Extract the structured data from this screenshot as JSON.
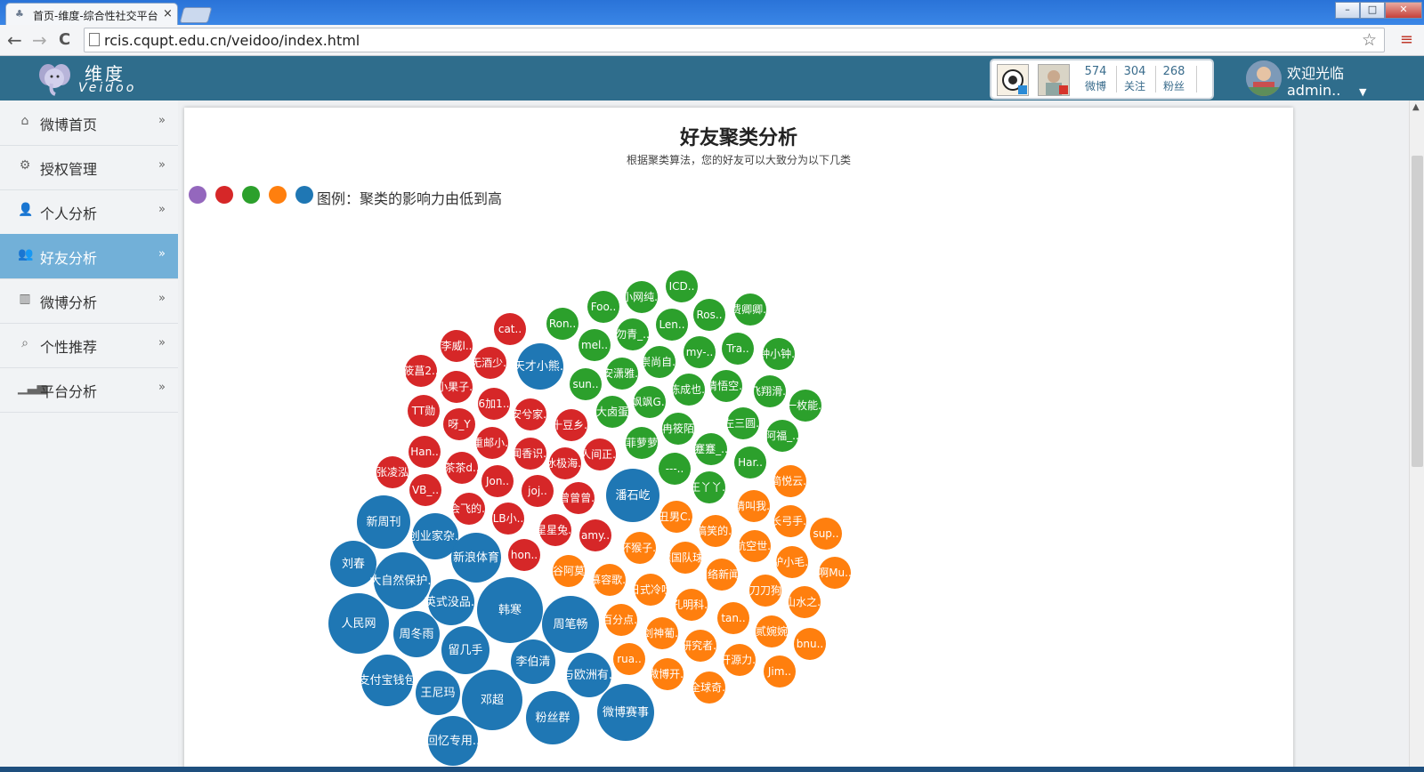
{
  "browser": {
    "tab_title": "首页-维度-综合性社交平台",
    "tab_close": "×",
    "url": "rcis.cqupt.edu.cn/veidoo/index.html",
    "back": "←",
    "forward": "→",
    "reload": "C",
    "star": "☆",
    "menu": "≡",
    "win_min": "–",
    "win_max": "□",
    "win_close": "✕"
  },
  "header": {
    "logo_title": "维度",
    "logo_sub": "Veidoo",
    "stats": [
      {
        "value": "574",
        "label": "微博"
      },
      {
        "value": "304",
        "label": "关注"
      },
      {
        "value": "268",
        "label": "粉丝"
      }
    ],
    "welcome": "欢迎光临",
    "user": "admin..",
    "caret": "▼"
  },
  "sidebar": {
    "items": [
      {
        "label": "微博首页",
        "icon": "home-icon",
        "glyph": "⌂",
        "arrow": "»"
      },
      {
        "label": "授权管理",
        "icon": "gears-icon",
        "glyph": "⚙",
        "arrow": "»"
      },
      {
        "label": "个人分析",
        "icon": "user-icon",
        "glyph": "👤",
        "arrow": "»"
      },
      {
        "label": "好友分析",
        "icon": "users-icon",
        "glyph": "👥",
        "arrow": "»"
      },
      {
        "label": "微博分析",
        "icon": "bar-chart-icon",
        "glyph": "▥",
        "arrow": "»"
      },
      {
        "label": "个性推荐",
        "icon": "search-icon",
        "glyph": "⌕",
        "arrow": "»"
      },
      {
        "label": "平台分析",
        "icon": "signal-icon",
        "glyph": "▁▃▅",
        "arrow": "»"
      }
    ],
    "active_index": 3
  },
  "main": {
    "title": "好友聚类分析",
    "subtitle": "根据聚类算法，您的好友可以大致分为以下几类",
    "legend_text": "图例：聚类的影响力由低到高",
    "legend_colors": [
      "#9467bd",
      "#d62728",
      "#2ca02c",
      "#ff7f0e",
      "#1f77b4"
    ]
  },
  "chart_data": {
    "type": "bubble",
    "title": "好友聚类分析",
    "clusters": [
      {
        "color": "#d62728",
        "members": [
          "cat..",
          "李威l..",
          "无酒少..",
          "筱菖2..",
          "小果子..",
          "6加1..",
          "TT勋",
          "呀_Y",
          "安兮家..",
          "十豆乡..",
          "Han..",
          "重邮小..",
          "闻香识..",
          "人间正..",
          "张凌泓",
          "茶茶d..",
          "冰极海..",
          "VB_..",
          "Jon..",
          "joj..",
          "曾曾曾..",
          "会飞的..",
          "LB小..",
          "星星兔..",
          "amy..",
          "hon.."
        ]
      },
      {
        "color": "#2ca02c",
        "members": [
          "ICD..",
          "Foo..",
          "小网纯..",
          "Ron..",
          "Len..",
          "Ros..",
          "费卿卿..",
          "勿青_..",
          "mel..",
          "my-..",
          "Tra..",
          "钟小钟..",
          "崇尚自..",
          "安潇雅..",
          "sun..",
          "陈成也..",
          "清悟空..",
          "飞翔滑..",
          "飒飒G..",
          "大卤蛋",
          "一枚能..",
          "左三圆..",
          "冉筱陌",
          "阿福_..",
          "菲萝萝",
          "蹇蹇_..",
          "Har..",
          "---..",
          "王丫丫.."
        ]
      },
      {
        "color": "#ff7f0e",
        "members": [
          "简悦云..",
          "请叫我..",
          "丑男C..",
          "长弓手..",
          "搞笑的..",
          "sup..",
          "航空世..",
          "坏猴子..",
          "德国队球..",
          "驴小毛..",
          "啊Mu..",
          "谷阿莫",
          "网络新闻..",
          "慕容歌..",
          "刀刀狗",
          "日式冷吐",
          "山水之..",
          "孔明科..",
          "百分点..",
          "tan..",
          "剑神葡..",
          "贰婉婉",
          "研究者..",
          "bnu..",
          "开源力..",
          "rua..",
          "Jim..",
          "微博开..",
          "全球奇.."
        ]
      },
      {
        "color": "#1f77b4",
        "members": [
          "天才小熊..",
          "潘石屹",
          "新周刊",
          "创业家杂..",
          "刘春",
          "新浪体育",
          "大自然保护..",
          "英式没品..",
          "韩寒",
          "人民网",
          "周冬雨",
          "周笔畅",
          "留几手",
          "李伯清",
          "支付宝钱包",
          "与欧洲有..",
          "王尼玛",
          "邓超",
          "粉丝群",
          "微博赛事",
          "回忆专用.."
        ]
      }
    ]
  }
}
